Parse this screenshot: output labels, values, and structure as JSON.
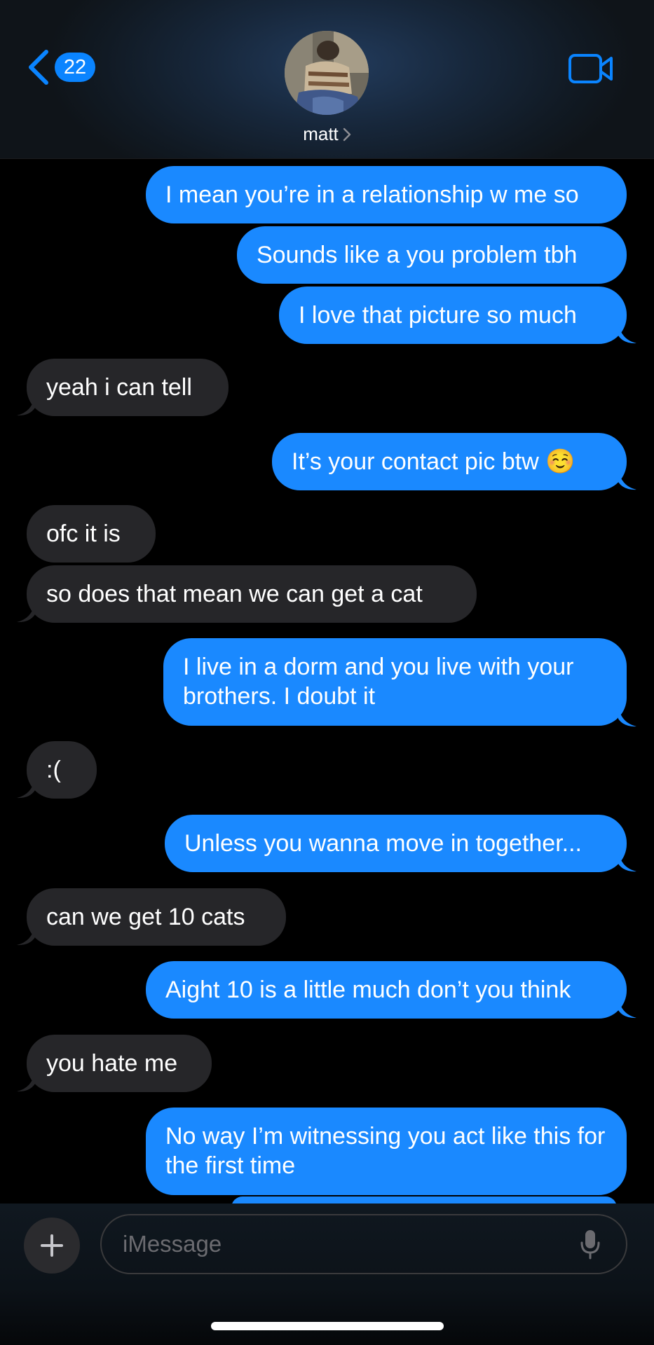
{
  "header": {
    "back_badge": "22",
    "contact_name": "matt"
  },
  "messages": [
    {
      "side": "sent",
      "text": "I mean you’re in a relationship w me so"
    },
    {
      "side": "sent",
      "text": "Sounds like a you problem tbh"
    },
    {
      "side": "sent",
      "text": "I love that picture so much"
    },
    {
      "side": "received",
      "text": "yeah i can tell"
    },
    {
      "side": "sent",
      "text": "It’s your contact pic btw ☺️"
    },
    {
      "side": "received",
      "text": "ofc it is"
    },
    {
      "side": "received",
      "text": "so does that mean we can get a cat"
    },
    {
      "side": "sent",
      "text": "I live in a dorm and you live with your brothers. I doubt it"
    },
    {
      "side": "received",
      "text": ":("
    },
    {
      "side": "sent",
      "text": "Unless you wanna move in together..."
    },
    {
      "side": "received",
      "text": "can we get 10 cats"
    },
    {
      "side": "sent",
      "text": "Aight 10 is a little much don’t you think"
    },
    {
      "side": "received",
      "text": "you hate me"
    },
    {
      "side": "sent",
      "text": "No way I’m witnessing you act like this for the first time"
    }
  ],
  "composer": {
    "placeholder": "iMessage"
  },
  "colors": {
    "sent_bubble": "#1a89ff",
    "received_bubble": "#262629",
    "accent": "#0a84ff",
    "background": "#000000"
  },
  "icons": {
    "back": "chevron-left-icon",
    "video": "video-camera-icon",
    "plus": "plus-icon",
    "mic": "microphone-icon",
    "name_chevron": "chevron-right-icon"
  }
}
